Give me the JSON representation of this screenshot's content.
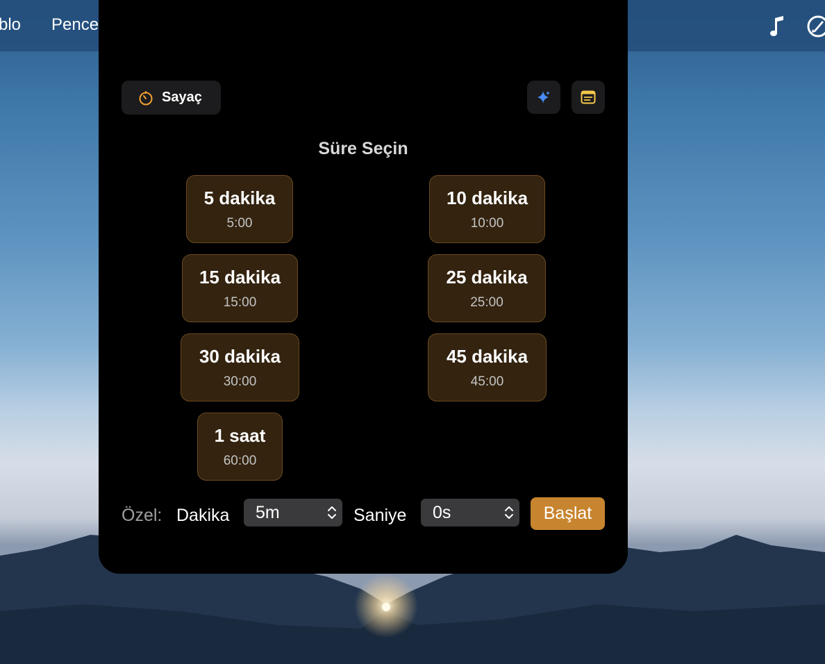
{
  "menubar": {
    "items": [
      "blo",
      "Pence"
    ],
    "icons": [
      "music-note-icon",
      "rocket-icon"
    ]
  },
  "timer_panel": {
    "mode": {
      "label": "Sayaç",
      "icon": "timer-icon",
      "accent": "#f0a030"
    },
    "toolbar_icons": [
      "sparkle-icon",
      "note-icon"
    ],
    "title": "Süre Seçin",
    "presets": [
      {
        "label": "5 dakika",
        "time": "5:00"
      },
      {
        "label": "10 dakika",
        "time": "10:00"
      },
      {
        "label": "15 dakika",
        "time": "15:00"
      },
      {
        "label": "25 dakika",
        "time": "25:00"
      },
      {
        "label": "30 dakika",
        "time": "30:00"
      },
      {
        "label": "45 dakika",
        "time": "45:00"
      },
      {
        "label": "1 saat",
        "time": "60:00"
      }
    ],
    "custom": {
      "label": "Özel:",
      "minutes_label": "Dakika",
      "minutes_value": "5m",
      "seconds_label": "Saniye",
      "seconds_value": "0s",
      "start_label": "Başlat"
    }
  },
  "colors": {
    "panel_bg": "#000000",
    "preset_bg": "#33230f",
    "preset_border": "#6b4a1f",
    "start_button": "#c8852f",
    "sparkle": "#4a8cf7",
    "note": "#f5c84a"
  }
}
